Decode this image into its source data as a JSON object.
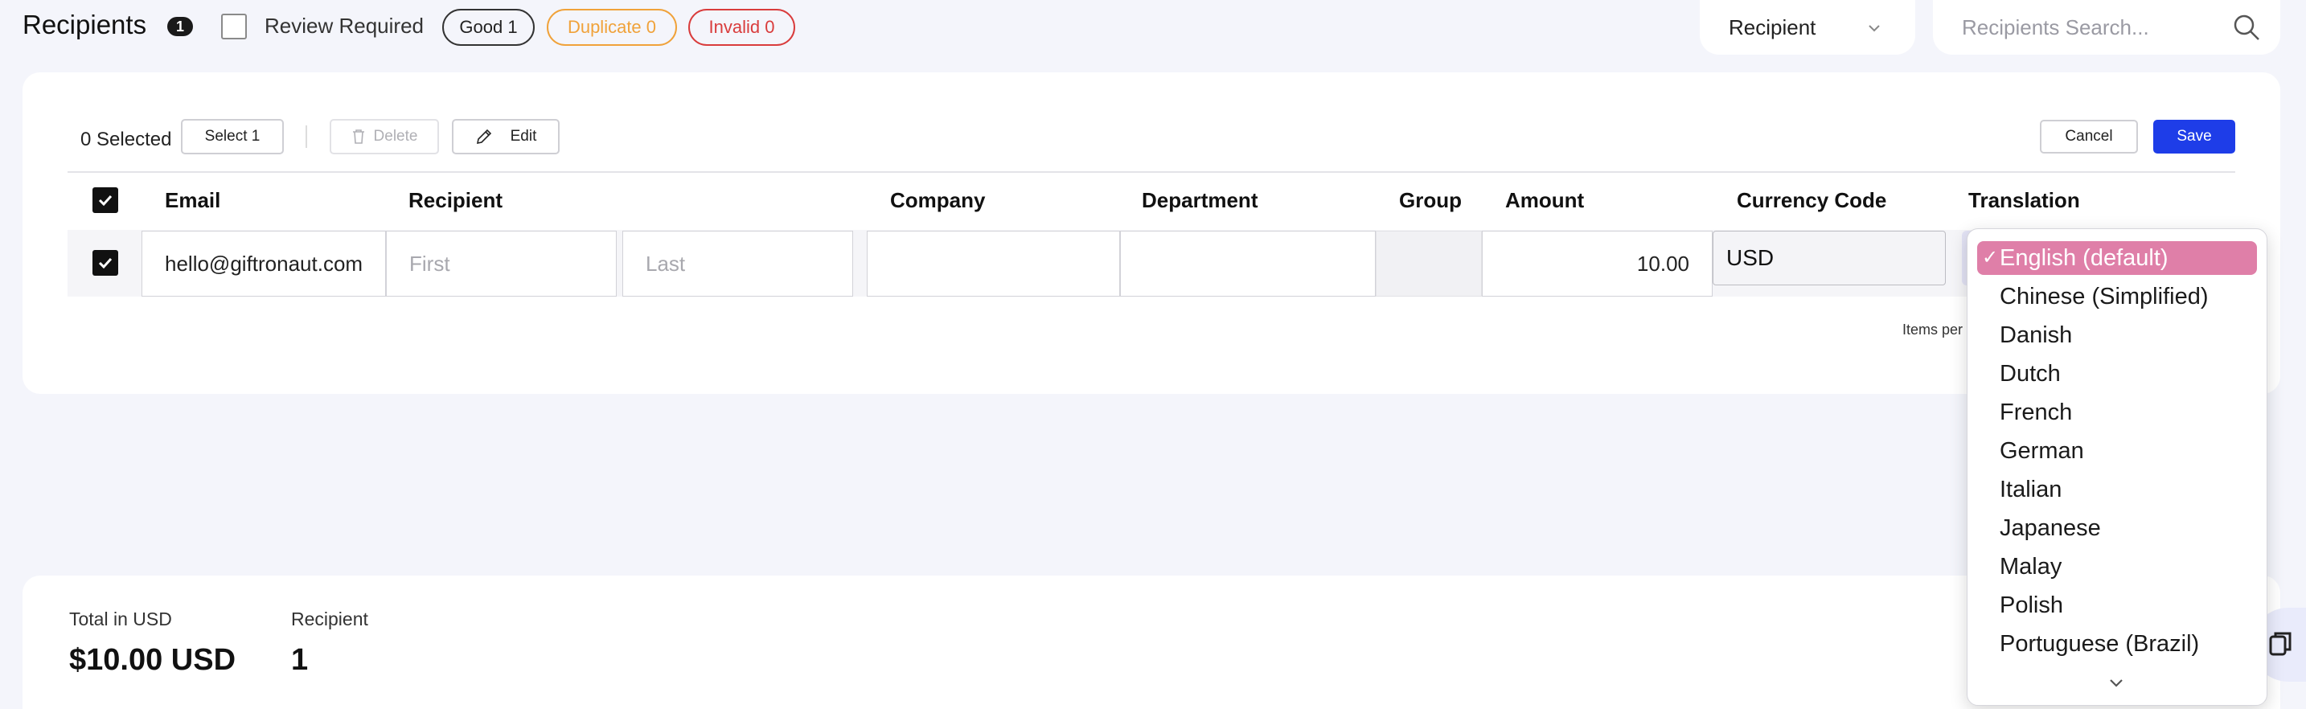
{
  "header": {
    "title": "Recipients",
    "count": "1",
    "review_label": "Review Required",
    "pill_good": "Good 1",
    "pill_duplicate": "Duplicate 0",
    "pill_invalid": "Invalid 0",
    "filter_select": "Recipient",
    "search_placeholder": "Recipients Search..."
  },
  "toolbar": {
    "selected_count": "0",
    "selected_label": "Selected",
    "select_btn": "Select 1",
    "delete_btn": "Delete",
    "edit_btn": "Edit",
    "cancel_btn": "Cancel",
    "save_btn": "Save"
  },
  "table": {
    "columns": [
      "Email",
      "Recipient",
      "Company",
      "Department",
      "Group",
      "Amount",
      "Currency Code",
      "Translation"
    ],
    "row": {
      "checked": true,
      "email": "hello@giftronaut.com",
      "first_placeholder": "First",
      "last_placeholder": "Last",
      "company": "",
      "department": "",
      "group": "",
      "amount": "10.00",
      "currency": "USD"
    },
    "items_per_page_label": "Items per"
  },
  "summary": {
    "total_label": "Total in USD",
    "total_value": "$10.00 USD",
    "recipient_label": "Recipient",
    "recipient_value": "1"
  },
  "translation_dropdown": {
    "selected": "English (default)",
    "options": [
      "English (default)",
      "Chinese (Simplified)",
      "Danish",
      "Dutch",
      "French",
      "German",
      "Italian",
      "Japanese",
      "Malay",
      "Polish",
      "Portuguese (Brazil)"
    ],
    "check_glyph": "✓"
  },
  "colors": {
    "accent": "#1e3de8",
    "selected_option": "#df7fa8",
    "duplicate": "#f0a23a",
    "invalid": "#d93c3c"
  }
}
